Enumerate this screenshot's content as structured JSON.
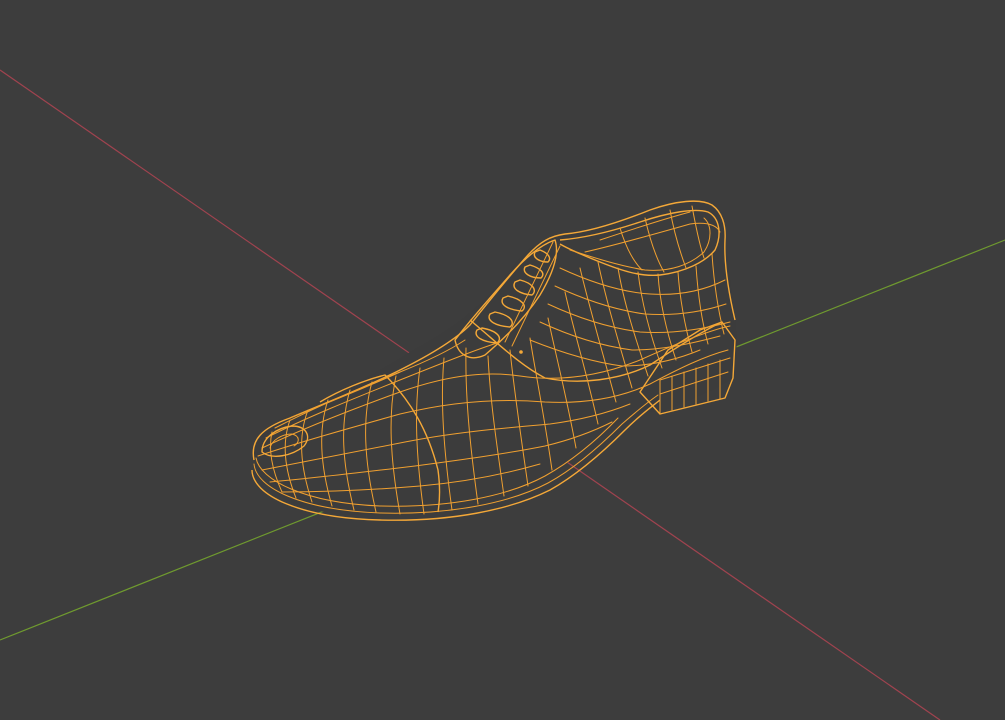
{
  "viewport": {
    "background": "#3d3d3d",
    "object_name": "Shoe",
    "display_mode": "wireframe",
    "object_selected": true
  },
  "axes": {
    "x_axis_color": "#a0434f",
    "y_axis_color": "#6f9a2f",
    "wire_color": "#f0a030"
  }
}
